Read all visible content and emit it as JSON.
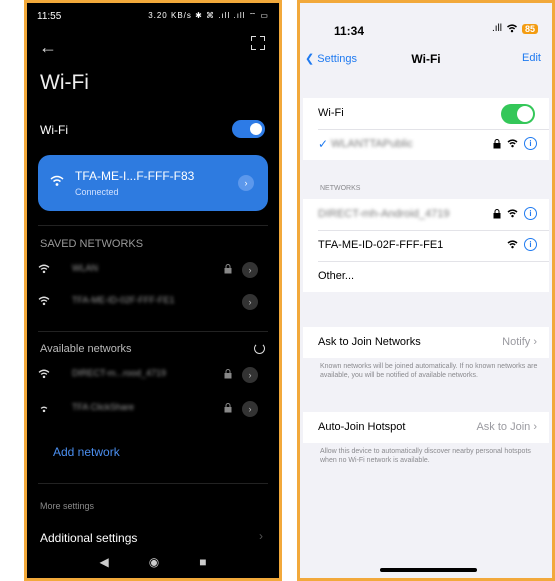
{
  "android": {
    "status": {
      "time": "11:55",
      "indicators": "3.20 KB/s ✱ ⌘ .ıll .ıll ⌔ ▭"
    },
    "title": "Wi-Fi",
    "wifi_label": "Wi-Fi",
    "wifi_on": true,
    "connected": {
      "name": "TFA-ME-I...F-FFF-F83",
      "status": "Connected"
    },
    "saved_header": "SAVED NETWORKS",
    "saved_networks": [
      {
        "name": "WLAN"
      },
      {
        "name": "TFA-ME-ID-02F-FFF-FE1"
      }
    ],
    "available_header": "Available networks",
    "available_networks": [
      {
        "name": "DIRECT-m...rood_4719"
      },
      {
        "name": "TFA ClickShare"
      }
    ],
    "add_network": "Add network",
    "more_settings": "More settings",
    "additional_settings": "Additional settings",
    "accent": "#2e7be0"
  },
  "ios": {
    "status": {
      "time": "11:34",
      "battery": "85"
    },
    "back_label": "Settings",
    "title": "Wi-Fi",
    "edit_label": "Edit",
    "wifi_label": "Wi-Fi",
    "wifi_on": true,
    "current_network": "WLANTTAPublic",
    "networks_header": "NETWORKS",
    "networks": [
      {
        "name": "DIRECT-mh-Android_4719"
      },
      {
        "name": "TFA-ME-ID-02F-FFF-FE1"
      }
    ],
    "other_label": "Other...",
    "ask_join_label": "Ask to Join Networks",
    "ask_join_value": "Notify",
    "ask_join_note": "Known networks will be joined automatically. If no known networks are available, you will be notified of available networks.",
    "auto_join_label": "Auto-Join Hotspot",
    "auto_join_value": "Ask to Join",
    "auto_join_note": "Allow this device to automatically discover nearby personal hotspots when no Wi-Fi network is available.",
    "accent": "#1f7af0"
  }
}
